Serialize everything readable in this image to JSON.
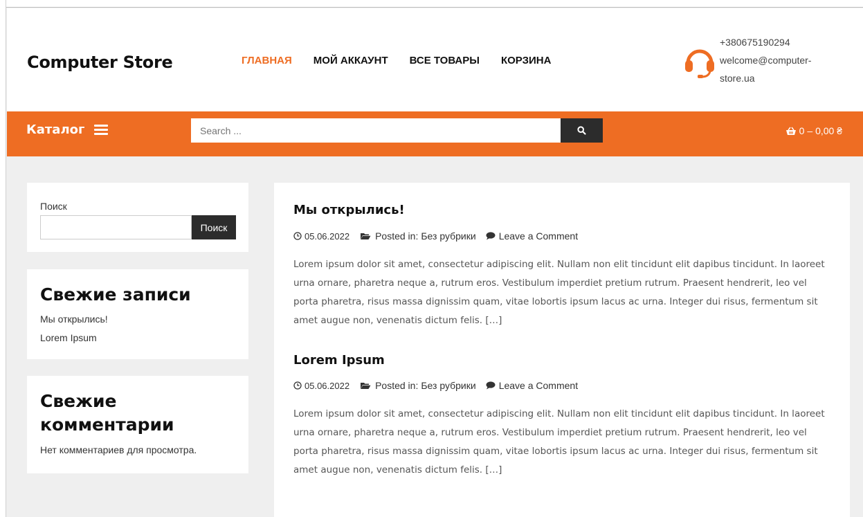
{
  "header": {
    "logo": "Computer Store",
    "nav": [
      {
        "label": "ГЛАВНАЯ",
        "active": true
      },
      {
        "label": "МОЙ АККАУНТ",
        "active": false
      },
      {
        "label": "ВСЕ ТОВАРЫ",
        "active": false
      },
      {
        "label": "КОРЗИНА",
        "active": false
      }
    ],
    "phone": "+380675190294",
    "email_line1": "welcome@computer-",
    "email_line2": "store.ua",
    "contact_icon": "headset-icon"
  },
  "bar": {
    "catalog_label": "Каталог",
    "search_placeholder": "Search ...",
    "search_icon": "search-icon",
    "cart_count": "0",
    "cart_total": "– 0,00 ₴",
    "cart_icon": "basket-icon"
  },
  "sidebar": {
    "search": {
      "label": "Поиск",
      "button": "Поиск"
    },
    "recent": {
      "title": "Свежие записи",
      "items": [
        "Мы открылись!",
        "Lorem Ipsum"
      ]
    },
    "comments": {
      "title": "Свежие комментарии",
      "empty": "Нет комментариев для просмотра."
    }
  },
  "posts": [
    {
      "title": "Мы открылись!",
      "date": "05.06.2022",
      "posted_in_label": "Posted in:",
      "category": "Без рубрики",
      "comment_link": "Leave a Comment",
      "excerpt": "Lorem ipsum dolor sit amet, consectetur adipiscing elit. Nullam non elit tincidunt elit dapibus tincidunt. In laoreet urna ornare, pharetra neque a, rutrum eros. Vestibulum imperdiet pretium rutrum. Praesent hendrerit, leo vel porta pharetra, risus massa dignissim quam, vitae lobortis ipsum lacus ac urna. Integer dui risus, fermentum sit amet augue non, venenatis dictum felis. […]"
    },
    {
      "title": "Lorem Ipsum",
      "date": "05.06.2022",
      "posted_in_label": "Posted in:",
      "category": "Без рубрики",
      "comment_link": "Leave a Comment",
      "excerpt": "Lorem ipsum dolor sit amet, consectetur adipiscing elit. Nullam non elit tincidunt elit dapibus tincidunt. In laoreet urna ornare, pharetra neque a, rutrum eros. Vestibulum imperdiet pretium rutrum. Praesent hendrerit, leo vel porta pharetra, risus massa dignissim quam, vitae lobortis ipsum lacus ac urna. Integer dui risus, fermentum sit amet augue non, venenatis dictum felis. […]"
    }
  ],
  "colors": {
    "accent": "#ee6d23",
    "dark": "#2c2c2c",
    "background": "#efefef"
  }
}
